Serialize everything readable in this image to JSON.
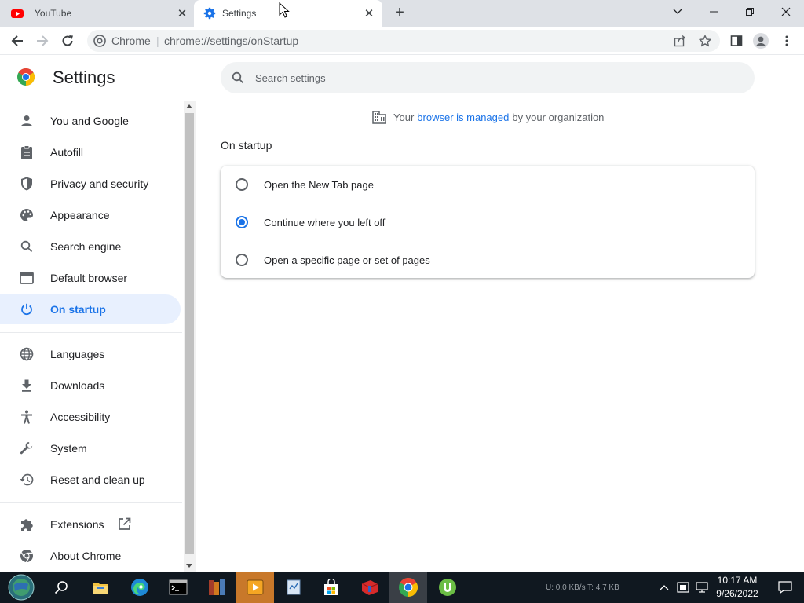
{
  "tabs": [
    {
      "title": "YouTube",
      "favicon": "youtube-icon",
      "active": false
    },
    {
      "title": "Settings",
      "favicon": "gear-icon",
      "active": true
    }
  ],
  "window_controls": {
    "tab_search": "chevron-down-icon",
    "minimize": "minimize-icon",
    "restore": "restore-icon",
    "close": "close-icon"
  },
  "address_bar": {
    "site_label": "Chrome",
    "url": "chrome://settings/onStartup"
  },
  "settings": {
    "title": "Settings",
    "search_placeholder": "Search settings"
  },
  "sidebar": {
    "items": [
      {
        "label": "You and Google",
        "icon": "person-icon"
      },
      {
        "label": "Autofill",
        "icon": "clipboard-icon"
      },
      {
        "label": "Privacy and security",
        "icon": "shield-icon"
      },
      {
        "label": "Appearance",
        "icon": "palette-icon"
      },
      {
        "label": "Search engine",
        "icon": "search-icon"
      },
      {
        "label": "Default browser",
        "icon": "browser-window-icon"
      },
      {
        "label": "On startup",
        "icon": "power-icon",
        "selected": true
      },
      {
        "label": "Languages",
        "icon": "globe-icon"
      },
      {
        "label": "Downloads",
        "icon": "download-icon"
      },
      {
        "label": "Accessibility",
        "icon": "accessibility-icon"
      },
      {
        "label": "System",
        "icon": "wrench-icon"
      },
      {
        "label": "Reset and clean up",
        "icon": "history-icon"
      },
      {
        "label": "Extensions",
        "icon": "puzzle-icon"
      },
      {
        "label": "About Chrome",
        "icon": "chrome-icon"
      }
    ]
  },
  "managed_notice": {
    "prefix": "Your",
    "link": "browser is managed",
    "suffix": "by your organization"
  },
  "on_startup": {
    "title": "On startup",
    "options": [
      {
        "label": "Open the New Tab page",
        "checked": false
      },
      {
        "label": "Continue where you left off",
        "checked": true
      },
      {
        "label": "Open a specific page or set of pages",
        "checked": false
      }
    ]
  },
  "taskbar": {
    "network_stats": "U: 0.0 KB/s T: 4.7 KB",
    "time": "10:17 AM",
    "date": "9/26/2022"
  },
  "colors": {
    "accent": "#1a73e8",
    "selected_bg": "#e8f0fe",
    "taskbar": "#101820"
  }
}
